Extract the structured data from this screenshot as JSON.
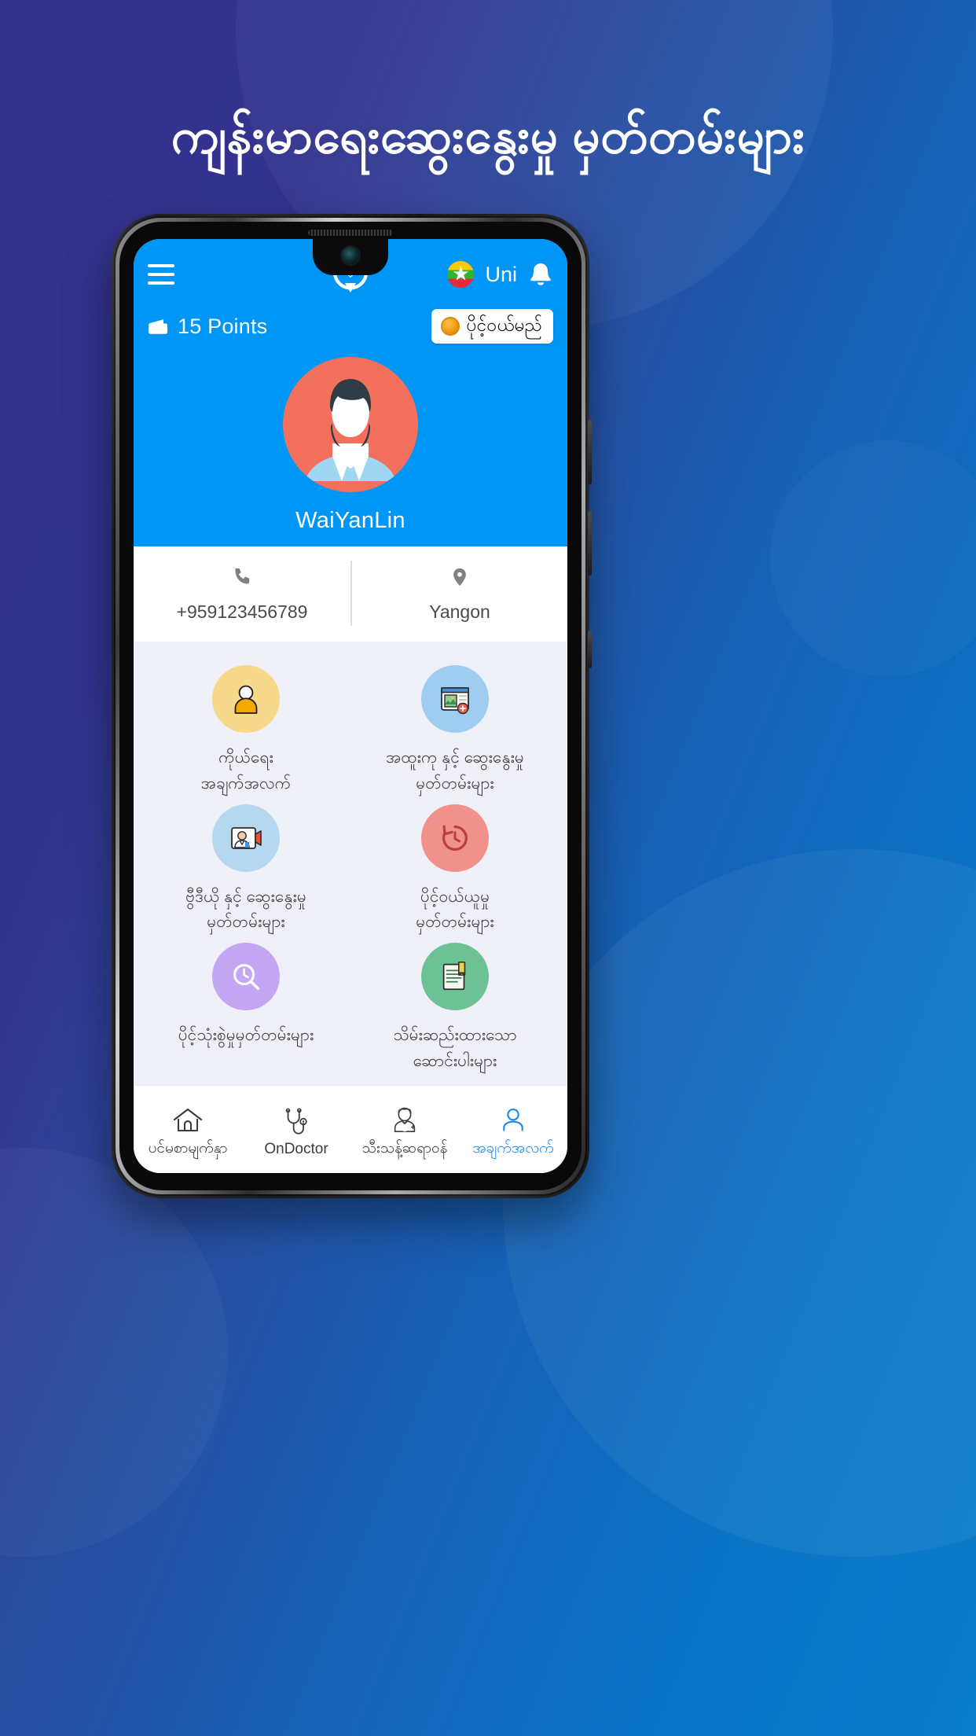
{
  "promo": {
    "headline": "ကျန်းမာရေးဆွေးနွေးမှု မှတ်တမ်းများ",
    "background_gradient_from": "#34318c",
    "background_gradient_to": "#0a7cc9"
  },
  "app": {
    "accent_color": "#0096f6",
    "appbar": {
      "menu_icon": "hamburger-menu-icon",
      "brand_logo_icon": "heartbeat-stethoscope-logo-icon",
      "flag_icon": "myanmar-flag-icon",
      "user_label": "Uni",
      "notification_icon": "bell-icon"
    },
    "points": {
      "wallet_icon": "wallet-icon",
      "label": "15 Points",
      "value": "15",
      "unit": "Points",
      "topup_button": {
        "coin_icon": "coin-icon",
        "label": "ပိုင့်ဝယ်မည်"
      }
    },
    "profile": {
      "avatar_icon": "user-avatar-photo",
      "name": "WaiYanLin",
      "contacts": [
        {
          "icon": "phone-icon",
          "value": "+959123456789",
          "name": "phone"
        },
        {
          "icon": "location-pin-icon",
          "value": "Yangon",
          "name": "location"
        }
      ]
    },
    "menu": [
      {
        "id": "personal-info",
        "icon": "person-icon",
        "icon_bg": "#f6d98a",
        "label_line1": "ကိုယ်ရေး",
        "label_line2": "အချက်အလက်"
      },
      {
        "id": "specialist-consultation-records",
        "icon": "specialist-consult-icon",
        "icon_bg": "#9fcdf0",
        "label_line1": "အထူးကု နှင့် ဆွေးနွေးမှု",
        "label_line2": "မှတ်တမ်းများ"
      },
      {
        "id": "video-consultation-records",
        "icon": "video-consult-icon",
        "icon_bg": "#b6d8ef",
        "label_line1": "ဗွီဒီယို နှင့် ဆွေးနွေးမှု",
        "label_line2": "မှတ်တမ်းများ"
      },
      {
        "id": "point-usage-records",
        "icon": "history-clock-icon",
        "icon_bg": "#f0918c",
        "label_line1": "ပိုင့်ဝယ်ယူမှု",
        "label_line2": "မှတ်တမ်းများ"
      },
      {
        "id": "point-spend-records",
        "icon": "search-clock-icon",
        "icon_bg": "#c4a7f2",
        "label_line1": "ပိုင့်သုံးစွဲမှုမှတ်တမ်းများ",
        "label_line2": ""
      },
      {
        "id": "saved-medicines",
        "icon": "saved-prescription-icon",
        "icon_bg": "#6dc295",
        "label_line1": "သိမ်းဆည်းထားသော",
        "label_line2": "ဆောင်းပါးများ"
      }
    ],
    "bottom_nav": {
      "active_color": "#1a8cf0",
      "items": [
        {
          "id": "home",
          "icon": "home-icon",
          "label": "ပင်မစာမျက်နှာ",
          "active": false
        },
        {
          "id": "ondoctor",
          "icon": "stethoscope-icon",
          "label": "OnDoctor",
          "active": false
        },
        {
          "id": "doctors",
          "icon": "doctor-icon",
          "label": "သီးသန့်ဆရာဝန်",
          "active": false
        },
        {
          "id": "profile",
          "icon": "user-icon",
          "label": "အချက်အလက်",
          "active": true
        }
      ]
    }
  }
}
